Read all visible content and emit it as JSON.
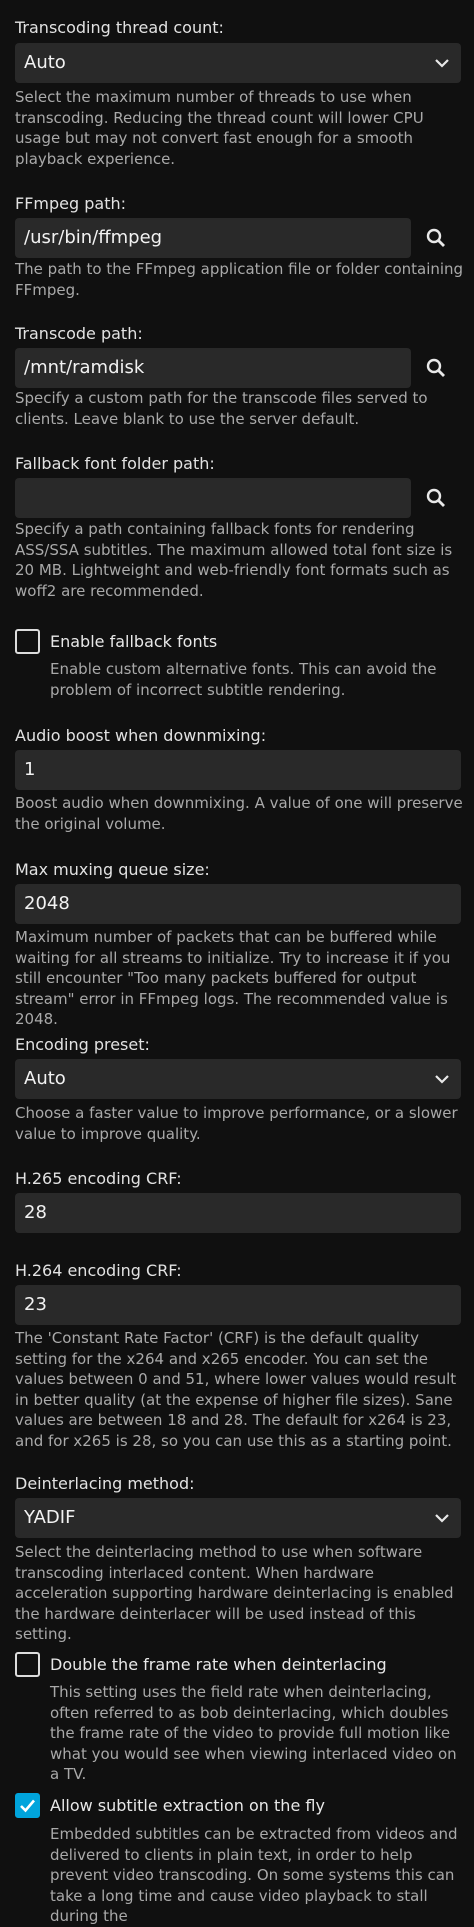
{
  "transcoding_thread_count": {
    "label": "Transcoding thread count:",
    "value": "Auto",
    "help": "Select the maximum number of threads to use when transcoding. Reducing the thread count will lower CPU usage but may not convert fast enough for a smooth playback experience."
  },
  "ffmpeg_path": {
    "label": "FFmpeg path:",
    "value": "/usr/bin/ffmpeg",
    "help": "The path to the FFmpeg application file or folder containing FFmpeg."
  },
  "transcode_path": {
    "label": "Transcode path:",
    "value": "/mnt/ramdisk",
    "help": "Specify a custom path for the transcode files served to clients. Leave blank to use the server default."
  },
  "fallback_font_path": {
    "label": "Fallback font folder path:",
    "value": "",
    "help": "Specify a path containing fallback fonts for rendering ASS/SSA subtitles. The maximum allowed total font size is 20 MB. Lightweight and web-friendly font formats such as woff2 are recommended."
  },
  "enable_fallback_fonts": {
    "label": "Enable fallback fonts",
    "checked": false,
    "help": "Enable custom alternative fonts. This can avoid the problem of incorrect subtitle rendering."
  },
  "audio_boost": {
    "label": "Audio boost when downmixing:",
    "value": "1",
    "help": "Boost audio when downmixing. A value of one will preserve the original volume."
  },
  "max_muxing_queue": {
    "label": "Max muxing queue size:",
    "value": "2048",
    "help": "Maximum number of packets that can be buffered while waiting for all streams to initialize. Try to increase it if you still encounter \"Too many packets buffered for output stream\" error in FFmpeg logs. The recommended value is 2048."
  },
  "encoding_preset": {
    "label": "Encoding preset:",
    "value": "Auto",
    "help": "Choose a faster value to improve performance, or a slower value to improve quality."
  },
  "h265_crf": {
    "label": "H.265 encoding CRF:",
    "value": "28"
  },
  "h264_crf": {
    "label": "H.264 encoding CRF:",
    "value": "23",
    "help": "The 'Constant Rate Factor' (CRF) is the default quality setting for the x264 and x265 encoder. You can set the values between 0 and 51, where lower values would result in better quality (at the expense of higher file sizes). Sane values are between 18 and 28. The default for x264 is 23, and for x265 is 28, so you can use this as a starting point."
  },
  "deinterlacing_method": {
    "label": "Deinterlacing method:",
    "value": "YADIF",
    "help": "Select the deinterlacing method to use when software transcoding interlaced content. When hardware acceleration supporting hardware deinterlacing is enabled the hardware deinterlacer will be used instead of this setting."
  },
  "double_frame_rate": {
    "label": "Double the frame rate when deinterlacing",
    "checked": false,
    "help": "This setting uses the field rate when deinterlacing, often referred to as bob deinterlacing, which doubles the frame rate of the video to provide full motion like what you would see when viewing interlaced video on a TV."
  },
  "subtitle_extraction": {
    "label": "Allow subtitle extraction on the fly",
    "checked": true,
    "help": "Embedded subtitles can be extracted from videos and delivered to clients in plain text, in order to help prevent video transcoding. On some systems this can take a long time and cause video playback to stall during the"
  },
  "colors": {
    "background": "#101010",
    "field": "#292929",
    "accent": "#00a4dc"
  },
  "icons": {
    "select": "chevron-down-icon",
    "browse": "search-icon",
    "check": "check-icon"
  }
}
